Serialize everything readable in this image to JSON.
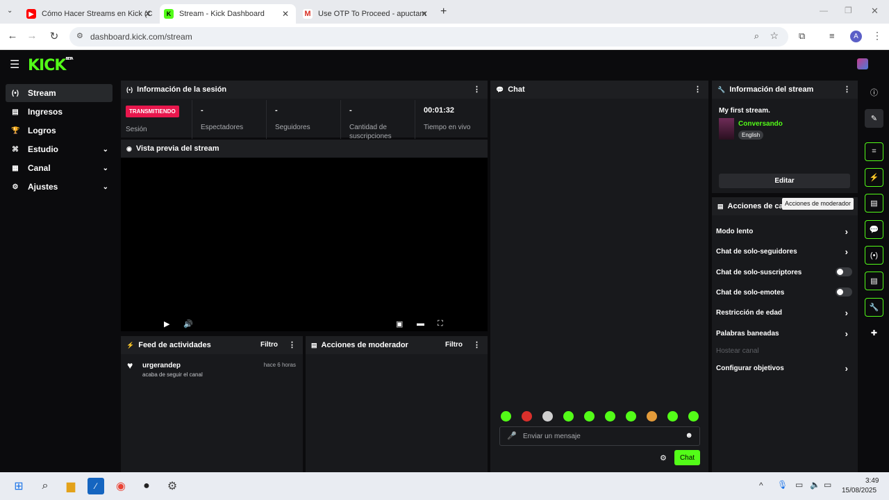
{
  "browser": {
    "tabs": [
      {
        "title": "Cómo Hacer Streams en Kick (C"
      },
      {
        "title": "Stream - Kick Dashboard"
      },
      {
        "title": "Use OTP To Proceed - apuctam"
      }
    ],
    "url": "dashboard.kick.com/stream",
    "profile_initial": "A"
  },
  "app": {
    "logo": "KICK",
    "logo_badge": "BETA"
  },
  "sidebar": {
    "items": [
      {
        "label": "Stream"
      },
      {
        "label": "Ingresos"
      },
      {
        "label": "Logros"
      },
      {
        "label": "Estudio"
      },
      {
        "label": "Canal"
      },
      {
        "label": "Ajustes"
      }
    ]
  },
  "session": {
    "title": "Información de la sesión",
    "live_badge": "TRANSMITIENDO",
    "session_label": "Sesión",
    "stats": [
      {
        "value": "-",
        "label": "Espectadores"
      },
      {
        "value": "-",
        "label": "Seguidores"
      },
      {
        "value": "-",
        "label": "Cantidad de suscripciones"
      },
      {
        "value": "00:01:32",
        "label": "Tiempo en vivo"
      }
    ]
  },
  "preview": {
    "title": "Vista previa del stream"
  },
  "activity": {
    "title": "Feed de actividades",
    "filter": "Filtro",
    "items": [
      {
        "user": "urgerandep",
        "time": "hace 6 horas",
        "text": "acaba de seguir el canal"
      }
    ]
  },
  "modactions": {
    "title": "Acciones de moderador",
    "filter": "Filtro"
  },
  "chat": {
    "title": "Chat",
    "placeholder": "Enviar un mensaje",
    "send": "Chat"
  },
  "streaminfo": {
    "title": "Información del stream",
    "stream_title": "My first stream.",
    "category": "Conversando",
    "language": "English",
    "edit": "Editar"
  },
  "channel_actions": {
    "title": "Acciones de canal",
    "tooltip": "Acciones de moderador",
    "rows": [
      {
        "label": "Modo lento"
      },
      {
        "label": "Chat de solo-seguidores"
      },
      {
        "label": "Chat de solo-suscriptores"
      },
      {
        "label": "Chat de solo-emotes"
      },
      {
        "label": "Restricción de edad"
      },
      {
        "label": "Palabras baneadas"
      },
      {
        "label": "Hostear canal"
      },
      {
        "label": "Configurar objetivos"
      }
    ]
  },
  "colors": {
    "accent": "#53fc18",
    "live": "#e8174d",
    "panel": "#18191c",
    "bg": "#0b0b0d"
  },
  "taskbar": {
    "time": "3:49",
    "date": "15/08/2025"
  }
}
